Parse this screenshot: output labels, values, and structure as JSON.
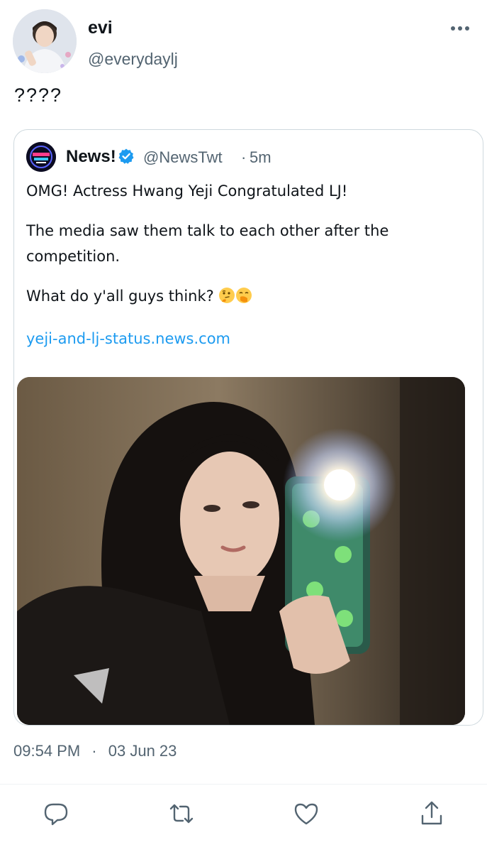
{
  "tweet": {
    "author_name": "evi",
    "author_handle": "@everydaylj",
    "text": "????",
    "time": "09:54 PM",
    "separator": "·",
    "date": "03 Jun 23"
  },
  "quoted": {
    "author_name": "News!",
    "author_handle": "@NewsTwt",
    "separator": "·",
    "time": "5m",
    "line1": "OMG! Actress Hwang Yeji Congratulated LJ!",
    "line2": "The media saw them talk to each other after the competition.",
    "line3": "What do y'all guys think?",
    "link": "yeji-and-lj-status.news.com",
    "emojis": [
      "thinking-face",
      "face-with-hand-over-mouth"
    ]
  },
  "icons": [
    "more-icon",
    "verified-icon",
    "reply-icon",
    "retweet-icon",
    "like-icon",
    "share-icon"
  ],
  "colors": {
    "link": "#1d9bf0",
    "text": "#0f1419",
    "secondary": "#536471",
    "border": "#cfd9de",
    "verified": "#1d9bf0"
  }
}
